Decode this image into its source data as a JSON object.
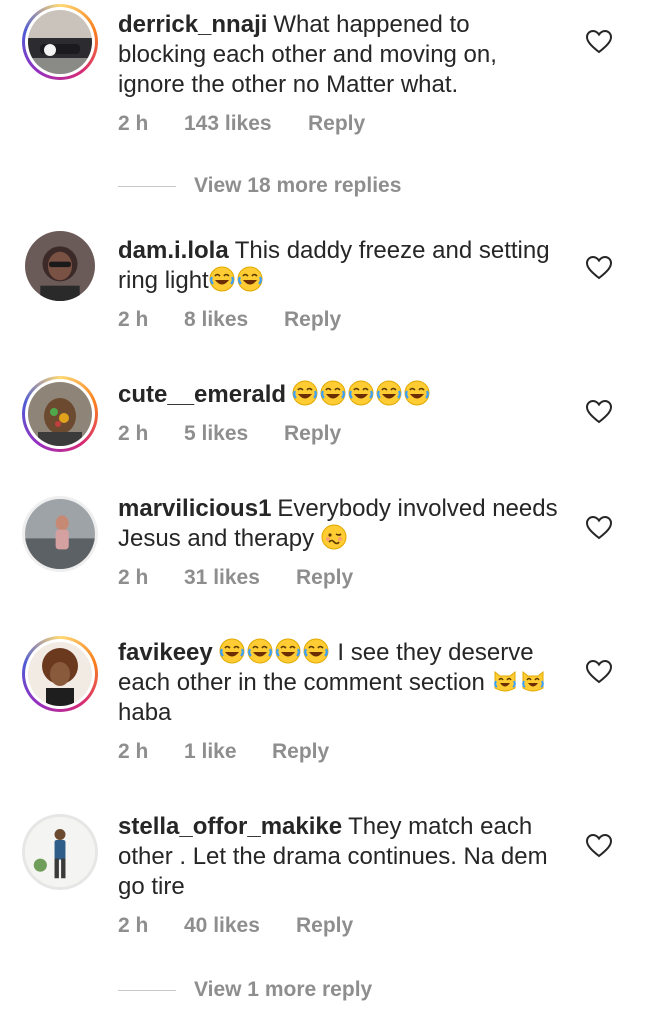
{
  "comments": [
    {
      "username": "derrick_nnaji",
      "text": "What happened to blocking each other and moving on, ignore the other no Matter what.",
      "time": "2 h",
      "likes": "143 likes",
      "reply": "Reply"
    },
    {
      "username": "dam.i.lola",
      "text": "This daddy freeze and setting ring light",
      "time": "2 h",
      "likes": "8 likes",
      "reply": "Reply"
    },
    {
      "username": "cute__emerald",
      "text": "",
      "time": "2 h",
      "likes": "5 likes",
      "reply": "Reply"
    },
    {
      "username": "marvilicious1",
      "text": "Everybody involved needs Jesus and therapy",
      "time": "2 h",
      "likes": "31 likes",
      "reply": "Reply"
    },
    {
      "username": "favikeey",
      "text_a": "I see they deserve each other in the comment section",
      "text_b": "haba",
      "time": "2 h",
      "likes": "1 like",
      "reply": "Reply"
    },
    {
      "username": "stella_offor_makike",
      "text": "They match each other . Let the drama continues. Na dem go tire",
      "time": "2 h",
      "likes": "40 likes",
      "reply": "Reply"
    }
  ],
  "view_more_1": "View 18 more replies",
  "view_more_2": "View 1 more reply",
  "icons": {
    "like": "heart-outline-icon",
    "emoji_laugh": "face-with-tears-of-joy",
    "emoji_woozy": "woozy-face",
    "emoji_cat": "cat-with-tears-of-joy"
  },
  "colors": {
    "text": "#262626",
    "meta": "#8e8e8e",
    "story_ring": "#d62976"
  }
}
